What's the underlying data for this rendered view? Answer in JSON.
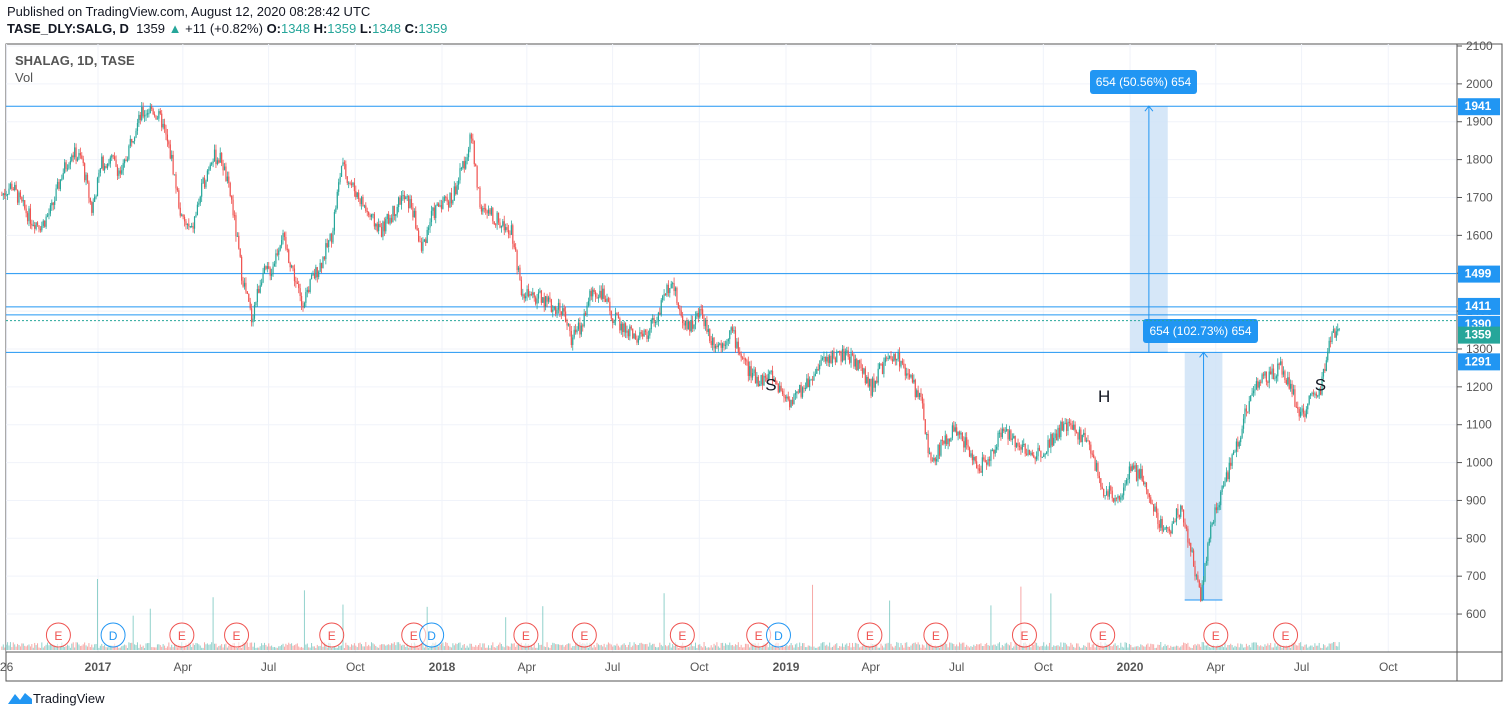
{
  "header": {
    "published": "Published on TradingView.com, August 12, 2020 08:28:42 UTC",
    "symbol": "TASE_DLY:SALG, D",
    "last": "1359",
    "change": "+11 (+0.82%)",
    "o_label": "O:",
    "o": "1348",
    "h_label": "H:",
    "h": "1359",
    "l_label": "L:",
    "l": "1348",
    "c_label": "C:",
    "c": "1359"
  },
  "legend": {
    "title": "SHALAG, 1D, TASE",
    "vol": "Vol"
  },
  "footer": {
    "brand": "TradingView"
  },
  "colors": {
    "up": "#26a69a",
    "down": "#ef5350",
    "drawing": "#2196f3",
    "box": "#cfe3f7",
    "grid": "#f0f3fa"
  },
  "chart_data": {
    "type": "candlestick",
    "price_axis": {
      "min": 600,
      "max": 2100,
      "ticks": [
        2100,
        2000,
        1900,
        1800,
        1700,
        1600,
        1500,
        1400,
        1300,
        1200,
        1100,
        1000,
        900,
        800,
        700,
        600
      ]
    },
    "time_axis": {
      "ticks": [
        {
          "label": "26",
          "date": "2016-09-26"
        },
        {
          "label": "2017",
          "date": "2017-01-01"
        },
        {
          "label": "Apr",
          "date": "2017-04-01"
        },
        {
          "label": "Jul",
          "date": "2017-07-01"
        },
        {
          "label": "Oct",
          "date": "2017-10-01"
        },
        {
          "label": "2018",
          "date": "2018-01-01"
        },
        {
          "label": "Apr",
          "date": "2018-04-01"
        },
        {
          "label": "Jul",
          "date": "2018-07-01"
        },
        {
          "label": "Oct",
          "date": "2018-10-01"
        },
        {
          "label": "2019",
          "date": "2019-01-01"
        },
        {
          "label": "Apr",
          "date": "2019-04-01"
        },
        {
          "label": "Jul",
          "date": "2019-07-01"
        },
        {
          "label": "Oct",
          "date": "2019-10-01"
        },
        {
          "label": "2020",
          "date": "2020-01-01"
        },
        {
          "label": "Apr",
          "date": "2020-04-01"
        },
        {
          "label": "Jul",
          "date": "2020-07-01"
        },
        {
          "label": "Oct",
          "date": "2020-10-01"
        }
      ]
    },
    "series_start": "2016-09-21",
    "series_step_days": 10.6,
    "closes": [
      1707,
      1733,
      1680,
      1640,
      1627,
      1670,
      1760,
      1820,
      1800,
      1667,
      1790,
      1800,
      1760,
      1860,
      1920,
      1935,
      1900,
      1800,
      1640,
      1610,
      1720,
      1810,
      1800,
      1690,
      1500,
      1380,
      1495,
      1510,
      1600,
      1520,
      1420,
      1480,
      1530,
      1600,
      1786,
      1733,
      1690,
      1640,
      1614,
      1654,
      1700,
      1680,
      1560,
      1650,
      1690,
      1695,
      1770,
      1860,
      1660,
      1654,
      1630,
      1620,
      1460,
      1430,
      1440,
      1410,
      1410,
      1330,
      1360,
      1450,
      1450,
      1390,
      1360,
      1340,
      1324,
      1360,
      1410,
      1490,
      1380,
      1360,
      1400,
      1324,
      1310,
      1350,
      1284,
      1231,
      1218,
      1231,
      1190,
      1160,
      1190,
      1225,
      1260,
      1280,
      1284,
      1275,
      1250,
      1195,
      1250,
      1270,
      1271,
      1215,
      1160,
      994,
      1045,
      1080,
      1070,
      1020,
      990,
      1020,
      1080,
      1070,
      1047,
      1015,
      1030,
      1060,
      1090,
      1095,
      1070,
      1040,
      935,
      915,
      914,
      980,
      965,
      900,
      835,
      825,
      885,
      765,
      650,
      830,
      910,
      1000,
      1080,
      1180,
      1220,
      1225,
      1250,
      1200,
      1120,
      1165,
      1195,
      1330,
      1359
    ],
    "last_price": 1359,
    "horizontal_levels": [
      1941,
      1499,
      1411,
      1390,
      1291
    ],
    "price_labels": [
      "1941",
      "1499",
      "1411",
      "1390",
      "1359",
      "1291"
    ],
    "measurements": [
      {
        "label": "654 (50.56%) 654",
        "from": 1291,
        "to": 1941,
        "start": "2020-01-01",
        "end": "2020-02-10"
      },
      {
        "label": "654 (102.73%) 654",
        "from": 637,
        "to": 1291,
        "start": "2020-02-28",
        "end": "2020-04-08"
      }
    ],
    "annotations": [
      {
        "text": "S",
        "date": "2018-12-10",
        "price": 1230
      },
      {
        "text": "H",
        "date": "2019-11-28",
        "price": 1200
      },
      {
        "text": "S",
        "date": "2020-07-15",
        "price": 1230
      }
    ],
    "events": [
      {
        "type": "E",
        "date": "2016-11-20"
      },
      {
        "type": "D",
        "date": "2017-01-17"
      },
      {
        "type": "E",
        "date": "2017-03-31"
      },
      {
        "type": "E",
        "date": "2017-05-28"
      },
      {
        "type": "E",
        "date": "2017-09-06"
      },
      {
        "type": "E",
        "date": "2017-12-02"
      },
      {
        "type": "D",
        "date": "2017-12-21"
      },
      {
        "type": "E",
        "date": "2018-03-31"
      },
      {
        "type": "E",
        "date": "2018-06-01"
      },
      {
        "type": "E",
        "date": "2018-09-13"
      },
      {
        "type": "E",
        "date": "2018-12-03"
      },
      {
        "type": "D",
        "date": "2018-12-24"
      },
      {
        "type": "E",
        "date": "2019-03-31"
      },
      {
        "type": "E",
        "date": "2019-06-09"
      },
      {
        "type": "E",
        "date": "2019-09-11"
      },
      {
        "type": "E",
        "date": "2019-12-03"
      },
      {
        "type": "E",
        "date": "2020-04-01"
      },
      {
        "type": "E",
        "date": "2020-06-14"
      }
    ]
  }
}
